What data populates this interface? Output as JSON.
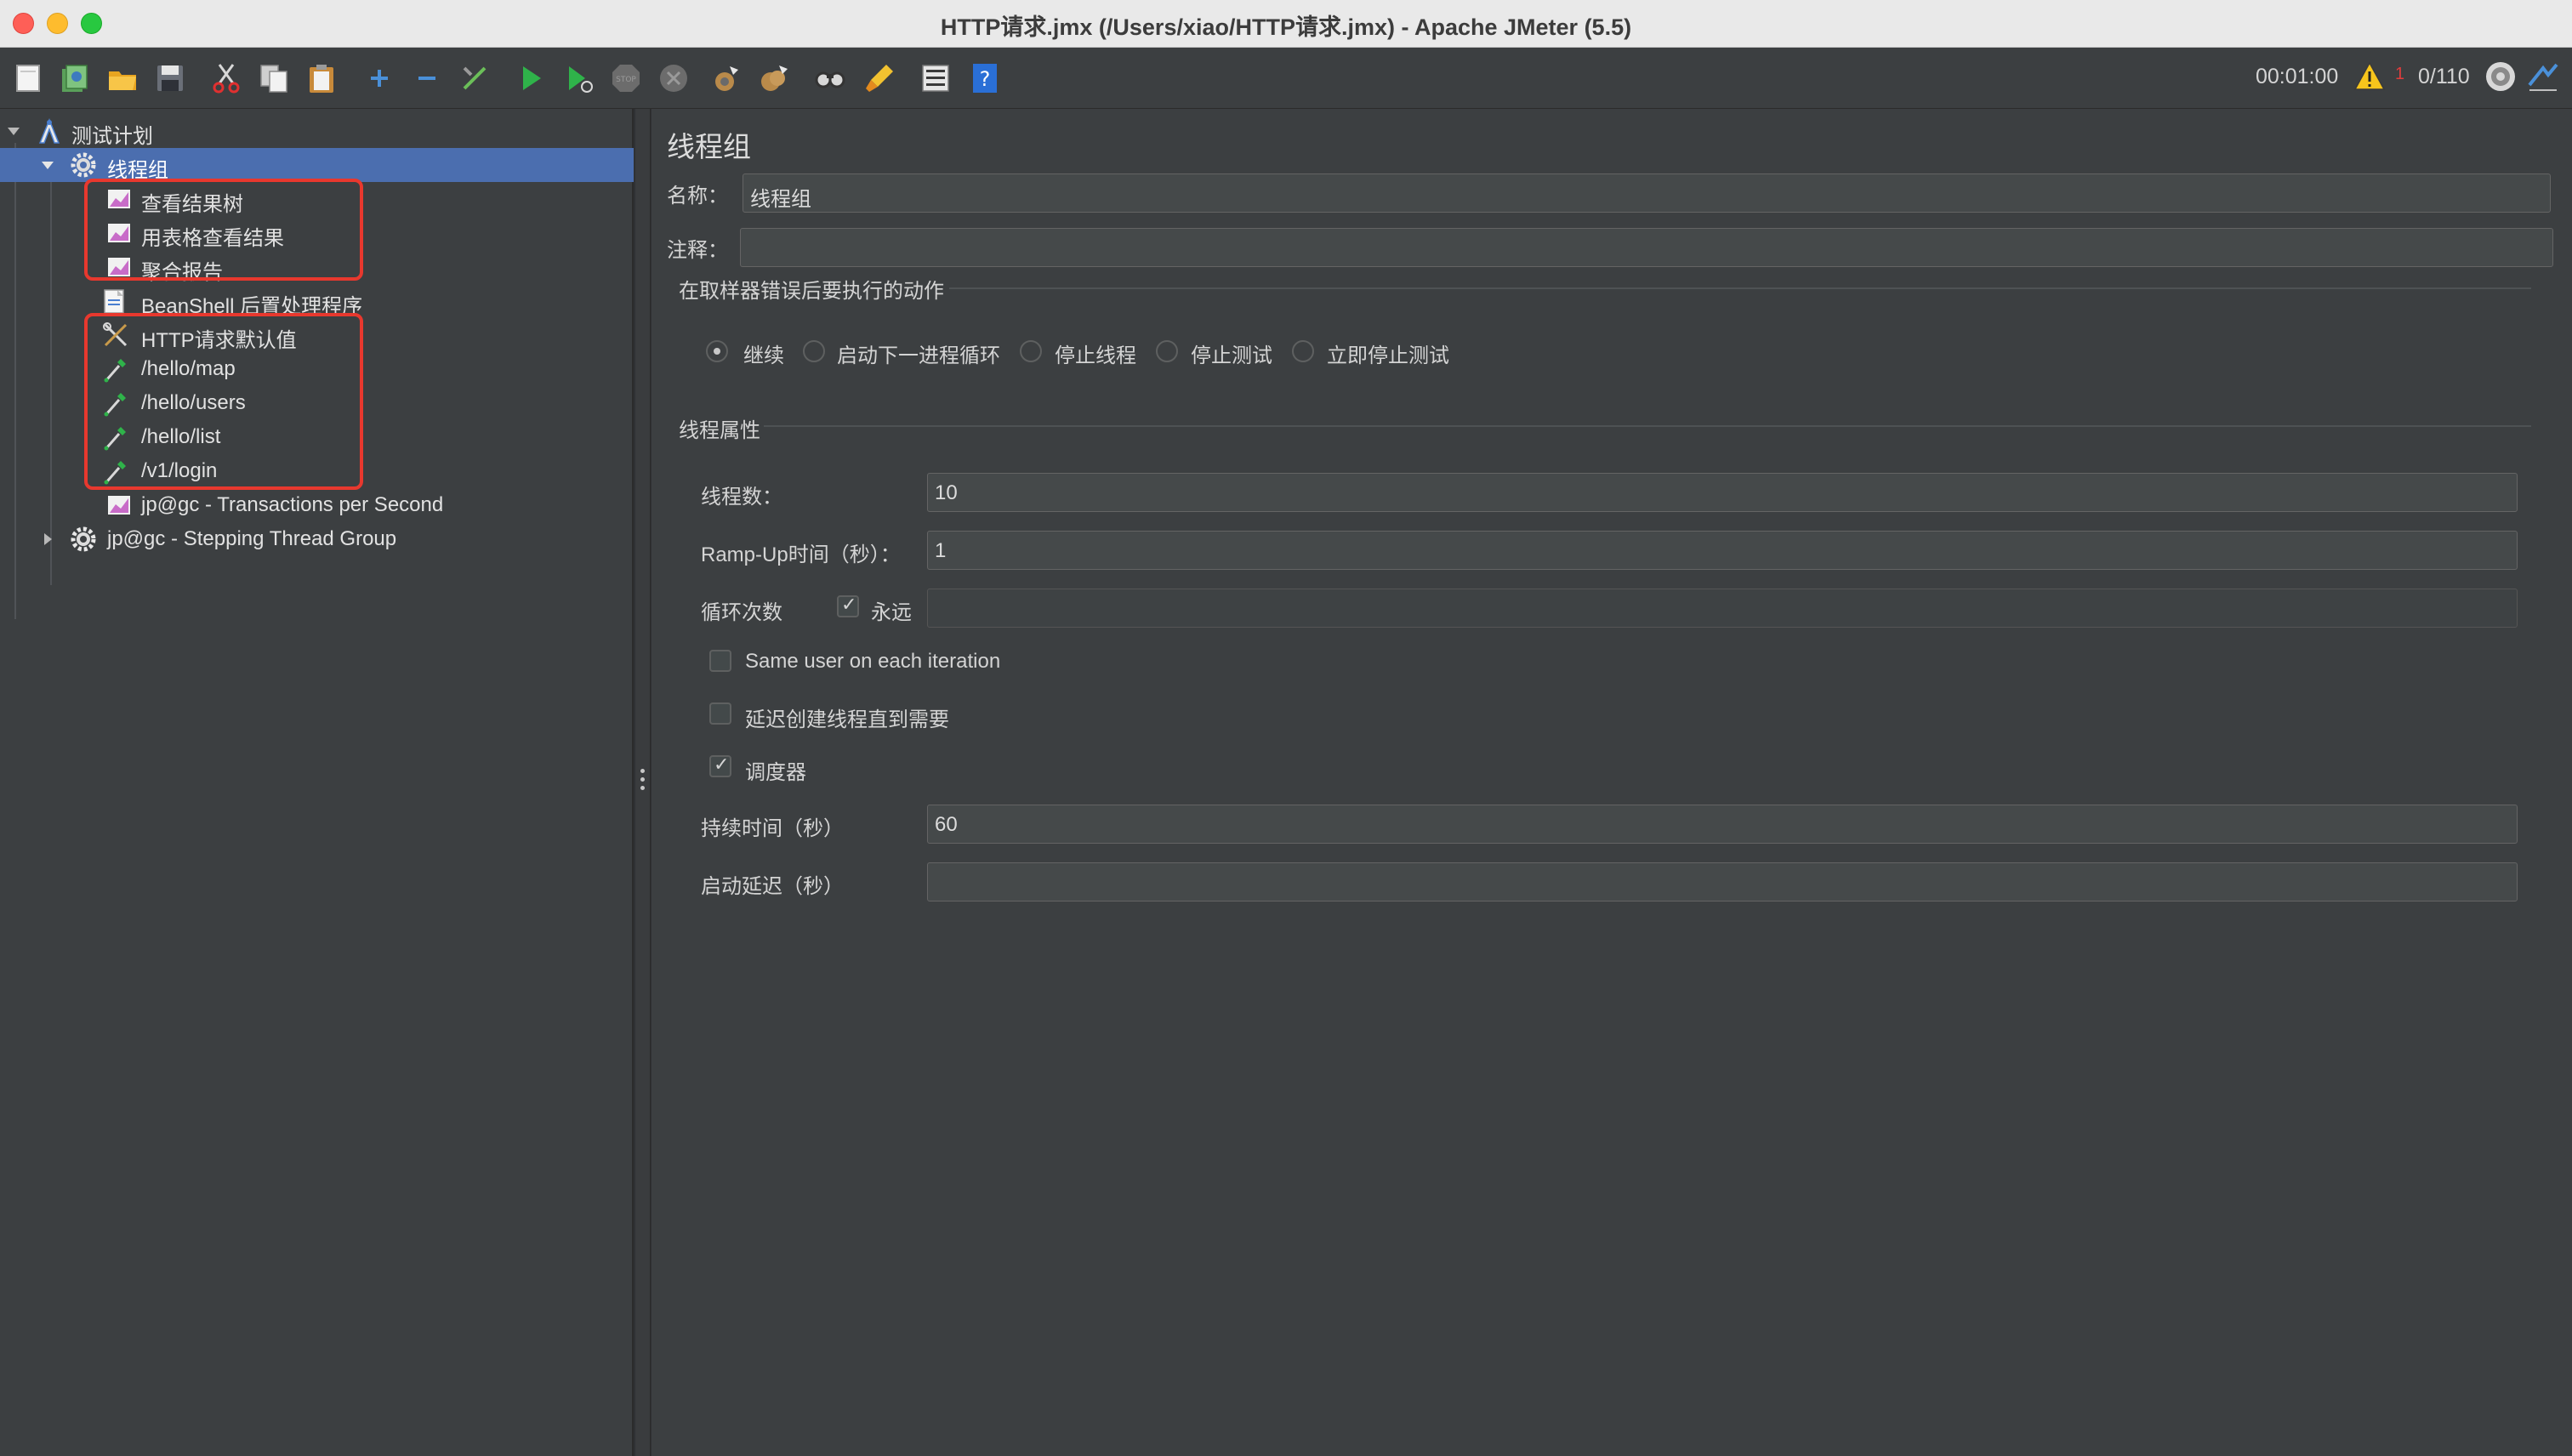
{
  "window": {
    "title": "HTTP请求.jmx (/Users/xiao/HTTP请求.jmx) - Apache JMeter (5.5)"
  },
  "toolbar": {
    "buttons": [
      "new-icon",
      "templates-icon",
      "open-icon",
      "save-icon",
      "cut-icon",
      "copy-icon",
      "paste-icon",
      "expand-icon",
      "collapse-icon",
      "toggle-icon",
      "start-icon",
      "start-no-pause-icon",
      "stop-icon",
      "shutdown-icon",
      "clear-icon",
      "clear-all-icon",
      "search-icon",
      "reset-search-icon",
      "function-helper-icon",
      "help-icon"
    ],
    "elapsed_time": "00:01:00",
    "error_count": "1",
    "thread_count": "0/110"
  },
  "tree": {
    "items": [
      {
        "label": "测试计划",
        "icon": "test-plan-icon"
      },
      {
        "label": "线程组",
        "icon": "gear-icon"
      },
      {
        "label": "查看结果树",
        "icon": "listener-icon"
      },
      {
        "label": "用表格查看结果",
        "icon": "listener-icon"
      },
      {
        "label": "聚合报告",
        "icon": "listener-icon"
      },
      {
        "label": "BeanShell 后置处理程序",
        "icon": "script-icon"
      },
      {
        "label": "HTTP请求默认值",
        "icon": "config-tools-icon"
      },
      {
        "label": "/hello/map",
        "icon": "sampler-pipette-icon"
      },
      {
        "label": "/hello/users",
        "icon": "sampler-pipette-icon"
      },
      {
        "label": "/hello/list",
        "icon": "sampler-pipette-icon"
      },
      {
        "label": "/v1/login",
        "icon": "sampler-pipette-icon"
      },
      {
        "label": "jp@gc - Transactions per Second",
        "icon": "listener-icon"
      },
      {
        "label": "jp@gc - Stepping Thread Group",
        "icon": "gear-icon"
      }
    ]
  },
  "panel": {
    "title": "线程组",
    "name_label": "名称：",
    "name_value": "线程组",
    "comment_label": "注释：",
    "comment_value": "",
    "error_action_title": "在取样器错误后要执行的动作",
    "error_actions": [
      {
        "label": "继续",
        "checked": true
      },
      {
        "label": "启动下一进程循环",
        "checked": false
      },
      {
        "label": "停止线程",
        "checked": false
      },
      {
        "label": "停止测试",
        "checked": false
      },
      {
        "label": "立即停止测试",
        "checked": false
      }
    ],
    "thread_props_title": "线程属性",
    "threads_label": "线程数：",
    "threads_value": "10",
    "rampup_label": "Ramp-Up时间（秒）：",
    "rampup_value": "1",
    "loop_label": "循环次数",
    "loop_forever_label": "永远",
    "loop_forever_checked": true,
    "loop_value": "",
    "same_user_label": "Same user on each iteration",
    "same_user_checked": false,
    "delay_create_label": "延迟创建线程直到需要",
    "delay_create_checked": false,
    "scheduler_label": "调度器",
    "scheduler_checked": true,
    "duration_label": "持续时间（秒）",
    "duration_value": "60",
    "startup_delay_label": "启动延迟（秒）",
    "startup_delay_value": ""
  }
}
